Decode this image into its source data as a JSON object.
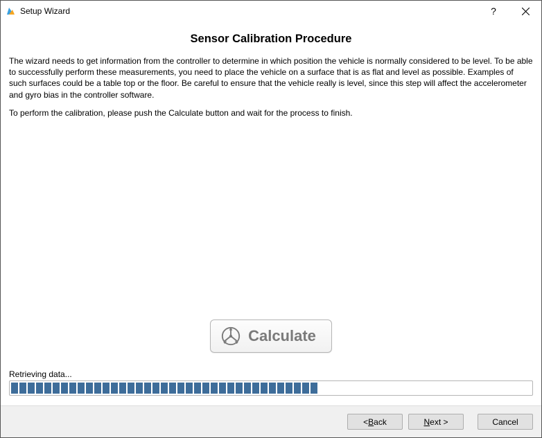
{
  "window": {
    "title": "Setup Wizard"
  },
  "page": {
    "heading": "Sensor Calibration Procedure",
    "paragraph1": "The wizard needs to get information from the controller to determine in which position the vehicle is normally considered to be level. To be able to successfully perform these measurements, you need to place the vehicle on a surface that is as flat and level as possible. Examples of such surfaces could be a table top or the floor. Be careful to ensure that the vehicle really is level, since this step will affect the accelerometer and gyro bias in the controller software.",
    "paragraph2": "To perform the calibration, please push the Calculate button and wait for the process to finish."
  },
  "actions": {
    "calculate_label": "Calculate"
  },
  "status": {
    "text": "Retrieving data...",
    "progress_chunks": 37,
    "progress_capacity": 63
  },
  "footer": {
    "back_prefix": "< ",
    "back_ul": "B",
    "back_rest": "ack",
    "next_ul": "N",
    "next_rest": "ext >",
    "cancel": "Cancel"
  }
}
